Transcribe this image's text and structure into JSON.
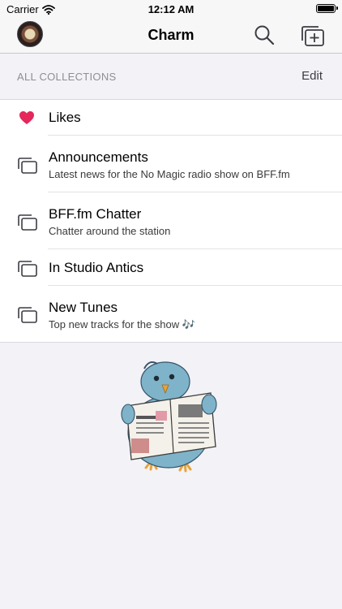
{
  "status_bar": {
    "carrier": "Carrier",
    "time": "12:12 AM",
    "icons": [
      "wifi-icon",
      "battery-icon"
    ]
  },
  "nav": {
    "title": "Charm",
    "left_icon": "avatar",
    "right_icons": [
      "search-icon",
      "add-collection-icon"
    ]
  },
  "section": {
    "header": "ALL COLLECTIONS",
    "edit_label": "Edit"
  },
  "collections": [
    {
      "title": "Likes",
      "subtitle": "",
      "icon": "heart-icon",
      "icon_color": "#e5275a"
    },
    {
      "title": "Announcements",
      "subtitle": "Latest news for the No Magic radio show on BFF.fm",
      "icon": "collection-icon"
    },
    {
      "title": "BFF.fm Chatter",
      "subtitle": "Chatter around the station",
      "icon": "collection-icon"
    },
    {
      "title": "In Studio Antics",
      "subtitle": "",
      "icon": "collection-icon"
    },
    {
      "title": "New Tunes",
      "subtitle": "Top new tracks for the show 🎶",
      "icon": "collection-icon"
    }
  ],
  "illustration": "bird-reading-newspaper",
  "colors": {
    "background": "#f2f2f7",
    "heart": "#e5275a",
    "icon_stroke": "#3c3c43",
    "section_text": "#8e8e93"
  }
}
